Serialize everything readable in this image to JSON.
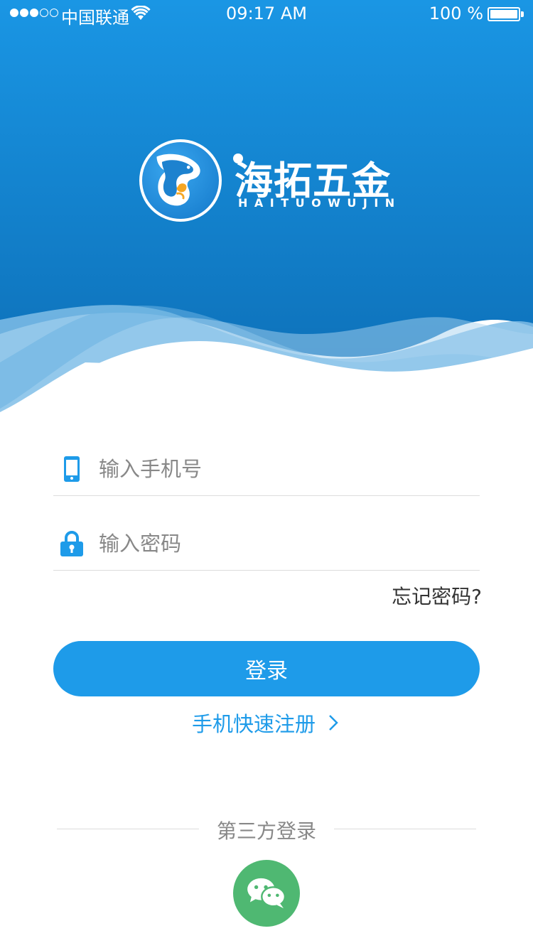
{
  "status_bar": {
    "carrier": "中国联通",
    "time": "09:17 AM",
    "battery": "100 %",
    "signal_bars_filled": 3,
    "signal_bars_total": 5
  },
  "brand": {
    "name": "海拓五金",
    "pinyin": "HAITUOWUJIN"
  },
  "form": {
    "phone_placeholder": "输入手机号",
    "password_placeholder": "输入密码",
    "forgot_label": "忘记密码?",
    "login_label": "登录",
    "register_label": "手机快速注册"
  },
  "third_party": {
    "label": "第三方登录",
    "providers": [
      "wechat-icon"
    ]
  },
  "colors": {
    "brand_blue": "#1e9be9",
    "header_top": "#1a96e4",
    "header_bottom": "#0d6fb8",
    "wechat_green": "#4fb872"
  }
}
